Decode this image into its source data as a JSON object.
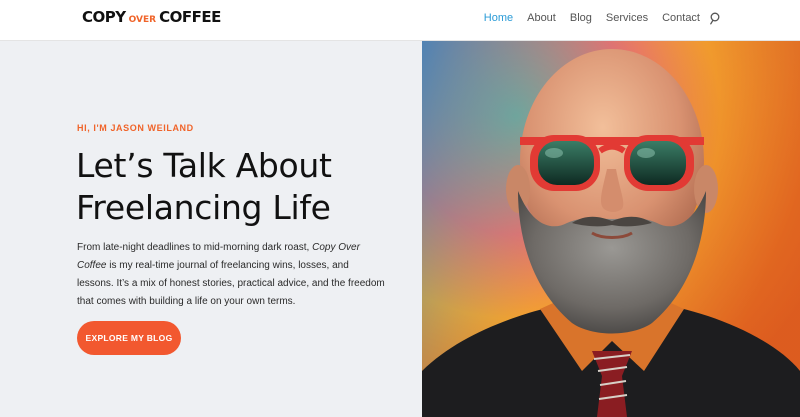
{
  "brand": {
    "logo_word1": "COPY",
    "logo_word2": "OVER",
    "logo_word3": "COFFEE"
  },
  "nav": {
    "items": [
      {
        "label": "Home",
        "active": true
      },
      {
        "label": "About"
      },
      {
        "label": "Blog"
      },
      {
        "label": "Services"
      },
      {
        "label": "Contact"
      }
    ],
    "search_icon": "search-icon"
  },
  "hero": {
    "eyebrow": "HI, I'M JASON WEILAND",
    "headline_line1": "Let’s Talk About",
    "headline_line2": "Freelancing Life",
    "intro_part1": "From late-night deadlines to mid-morning dark roast, ",
    "intro_em": "Copy Over Coffee",
    "intro_part2": " is my real-time journal of freelancing wins, losses, and lessons. It’s a mix of honest stories, practical advice, and the freedom that comes with building a life on your own terms.",
    "cta_label": "EXPLORE MY BLOG"
  },
  "colors": {
    "accent": "#f2582f",
    "nav_active": "#2a9bd7",
    "panel_bg": "#eef0f3"
  }
}
